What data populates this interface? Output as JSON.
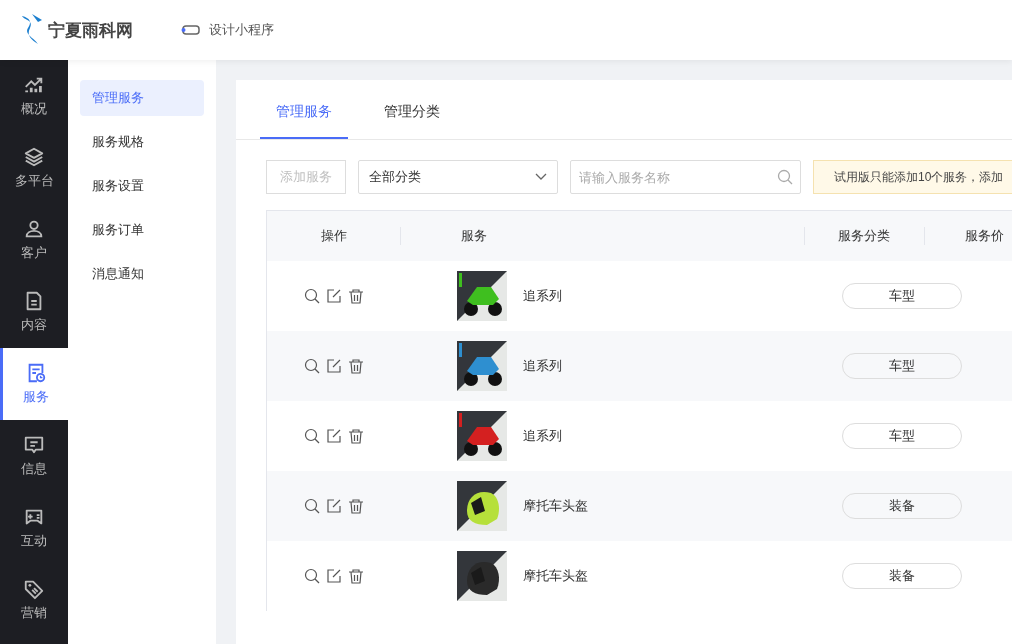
{
  "header": {
    "logo_text": "宁夏雨科网",
    "link": "设计小程序"
  },
  "rail": [
    {
      "label": "概况",
      "selected": false
    },
    {
      "label": "多平台",
      "selected": false
    },
    {
      "label": "客户",
      "selected": false
    },
    {
      "label": "内容",
      "selected": false
    },
    {
      "label": "服务",
      "selected": true
    },
    {
      "label": "信息",
      "selected": false
    },
    {
      "label": "互动",
      "selected": false
    },
    {
      "label": "营销",
      "selected": false
    }
  ],
  "submenu": [
    {
      "label": "管理服务",
      "selected": true
    },
    {
      "label": "服务规格",
      "selected": false
    },
    {
      "label": "服务设置",
      "selected": false
    },
    {
      "label": "服务订单",
      "selected": false
    },
    {
      "label": "消息通知",
      "selected": false
    }
  ],
  "tabs": [
    {
      "label": "管理服务",
      "selected": true
    },
    {
      "label": "管理分类",
      "selected": false
    }
  ],
  "toolbar": {
    "add_button": {
      "label": "添加服务",
      "disabled": true
    },
    "category_select": {
      "value": "全部分类"
    },
    "search": {
      "placeholder": "请输入服务名称"
    },
    "notice": "试用版只能添加10个服务，添加"
  },
  "table": {
    "columns": [
      "操作",
      "服务",
      "服务分类",
      "服务价"
    ],
    "rows": [
      {
        "name": "追系列",
        "category": "车型"
      },
      {
        "name": "追系列",
        "category": "车型"
      },
      {
        "name": "追系列",
        "category": "车型"
      },
      {
        "name": "摩托车头盔",
        "category": "装备"
      },
      {
        "name": "摩托车头盔",
        "category": "装备"
      }
    ]
  }
}
